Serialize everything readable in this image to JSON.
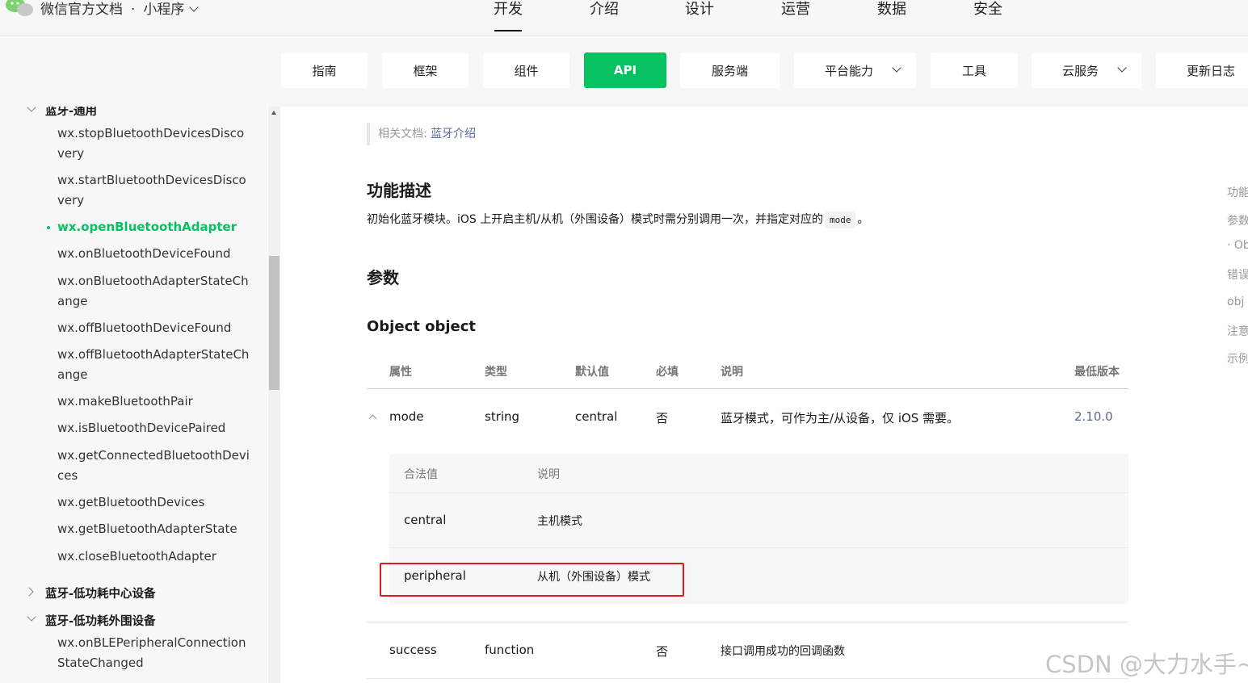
{
  "topbar": {
    "brand": "微信官方文档",
    "separator": "·",
    "product": "小程序",
    "nav": [
      "开发",
      "介绍",
      "设计",
      "运营",
      "数据",
      "安全"
    ]
  },
  "subnav": {
    "items": [
      "指南",
      "框架",
      "组件",
      "API",
      "服务端",
      "平台能力",
      "工具",
      "云服务",
      "更新日志"
    ],
    "active": "API"
  },
  "sidebar": {
    "group1": "蓝牙-通用",
    "items": [
      "wx.stopBluetoothDevicesDiscovery",
      "wx.startBluetoothDevicesDiscovery",
      "wx.openBluetoothAdapter",
      "wx.onBluetoothDeviceFound",
      "wx.onBluetoothAdapterStateChange",
      "wx.offBluetoothDeviceFound",
      "wx.offBluetoothAdapterStateChange",
      "wx.makeBluetoothPair",
      "wx.isBluetoothDevicePaired",
      "wx.getConnectedBluetoothDevices",
      "wx.getBluetoothDevices",
      "wx.getBluetoothAdapterState",
      "wx.closeBluetoothAdapter"
    ],
    "group2": "蓝牙-低功耗中心设备",
    "group3": "蓝牙-低功耗外围设备",
    "group3_items": [
      "wx.onBLEPeripheralConnectionStateChanged"
    ]
  },
  "content": {
    "related_prefix": "相关文档: ",
    "related_link": "蓝牙介绍",
    "section_desc_title": "功能描述",
    "desc_before": "初始化蓝牙模块。iOS 上开启主机/从机（外围设备）模式时需分别调用一次，并指定对应的",
    "desc_code": "mode",
    "desc_after": "。",
    "section_params_title": "参数",
    "object_title": "Object object",
    "table_headers": [
      "属性",
      "类型",
      "默认值",
      "必填",
      "说明",
      "最低版本"
    ],
    "rows": [
      {
        "name": "mode",
        "type": "string",
        "default": "central",
        "required": "否",
        "desc": "蓝牙模式，可作为主/从设备，仅 iOS 需要。",
        "version": "2.10.0"
      },
      {
        "name": "success",
        "type": "function",
        "default": "",
        "required": "否",
        "desc": "接口调用成功的回调函数",
        "version": ""
      }
    ],
    "sub_headers": [
      "合法值",
      "说明"
    ],
    "sub_rows": [
      {
        "value": "central",
        "desc": "主机模式"
      },
      {
        "value": "peripheral",
        "desc": "从机（外围设备）模式"
      }
    ]
  },
  "toc": [
    "功能",
    "参数",
    "· Ob",
    "错误",
    "obj",
    "注意",
    "示例"
  ],
  "watermark": "CSDN @大力水手~",
  "colors": {
    "accent": "#07c160",
    "link": "#576b95",
    "highlight": "#e0191c"
  }
}
